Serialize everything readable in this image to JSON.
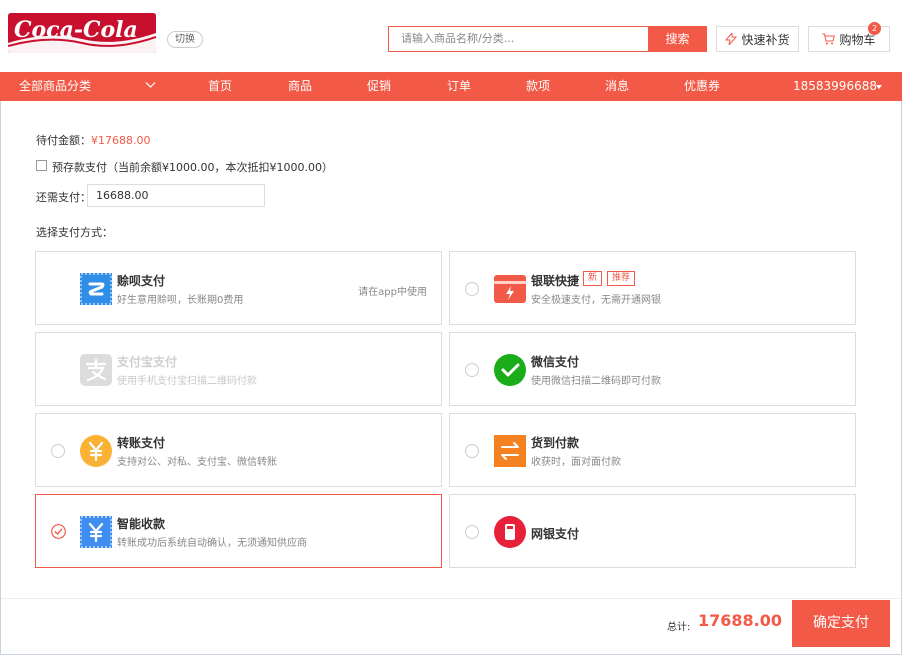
{
  "header": {
    "logo_text": "Coca-Cola",
    "switch_label": "切换",
    "search_placeholder": "请输入商品名称/分类...",
    "search_button": "搜索",
    "quick_restock": "快速补货",
    "cart_label": "购物车",
    "cart_count": "2"
  },
  "nav": {
    "category": "全部商品分类",
    "items": [
      "首页",
      "商品",
      "促销",
      "订单",
      "款项",
      "消息",
      "优惠券"
    ],
    "phone": "18583996688"
  },
  "payment": {
    "pending_label": "待付金额：",
    "pending_amount": "¥17688.00",
    "prepaid_text": "预存款支付（当前余额¥1000.00，本次抵扣¥1000.00）",
    "remaining_label": "还需支付：",
    "remaining_value": "16688.00",
    "method_label": "选择支付方式："
  },
  "methods": [
    {
      "title": "赊呗支付",
      "desc": "好生意用赊呗，长账期0费用",
      "hint": "请在app中使用"
    },
    {
      "title": "银联快捷",
      "desc": "安全极速支付，无需开通网银",
      "tags": [
        "新",
        "推荐"
      ]
    },
    {
      "title": "支付宝支付",
      "desc": "使用手机支付宝扫描二维码付款"
    },
    {
      "title": "微信支付",
      "desc": "使用微信扫描二维码即可付款"
    },
    {
      "title": "转账支付",
      "desc": "支持对公、对私、支付宝、微信转账"
    },
    {
      "title": "货到付款",
      "desc": "收获时，面对面付款"
    },
    {
      "title": "智能收款",
      "desc": "转账成功后系统自动确认，无须通知供应商"
    },
    {
      "title": "网银支付",
      "desc": ""
    }
  ],
  "footer": {
    "total_label": "总计:",
    "total_value": "17688.00",
    "confirm_button": "确定支付"
  },
  "colors": {
    "accent": "#f25a47",
    "brand_red": "#c8102e"
  }
}
